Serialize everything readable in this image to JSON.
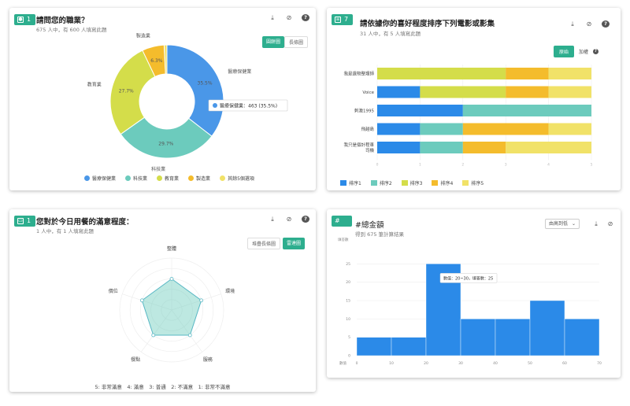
{
  "cards": [
    {
      "badge": "1",
      "title": "請問您的職業？",
      "subtitle": "675 人中，有 600 人填寫此題",
      "toggle": [
        "圓餅圖",
        "長條圖"
      ]
    },
    {
      "badge": "7",
      "title": "請依據你的喜好程度排序下列電影或影集",
      "subtitle": "31 人中，有 5 人填寫此題",
      "toggle": [
        "原始",
        "加權"
      ]
    },
    {
      "badge": "1",
      "title": "您對於今日用餐的滿意程度：",
      "subtitle": "1 人中，有 1 人填寫此題",
      "toggle": [
        "堆疊長條圖",
        "雷達圖"
      ],
      "scale_note": "5: 非常滿意　4: 滿意　3: 普通　2: 不滿意　1: 非常不滿意"
    },
    {
      "badge": "#",
      "title": "#總金額",
      "subtitle": "得到 675 筆計算結果",
      "dropdown": "由高到低"
    }
  ],
  "chart_data": [
    {
      "type": "pie",
      "title": "請問您的職業？",
      "categories": [
        "醫療保健業",
        "科技業",
        "教育業",
        "製造業",
        "其餘5個選項"
      ],
      "values": [
        35.5,
        29.7,
        27.7,
        6.3,
        0.8
      ],
      "labels": [
        "醫療保健業",
        "科技業",
        "教育業",
        "製造業",
        ""
      ],
      "value_labels": [
        "35.5%",
        "29.7%",
        "27.7%",
        "6.3%",
        ""
      ],
      "colors": [
        "#4a97e8",
        "#6ccbbd",
        "#d4dd4a",
        "#f4bc2c",
        "#f1e268"
      ],
      "tooltip": "醫療保健業：463 (35.5%)"
    },
    {
      "type": "bar",
      "orientation": "horizontal",
      "stacked": true,
      "categories": [
        "我是遺物整理師",
        "Voice",
        "刺激1995",
        "飛越島",
        "我只是個計程車司機"
      ],
      "series": [
        {
          "name": "排序1",
          "color": "#2b8ae8",
          "values": [
            0,
            1,
            2,
            1,
            1
          ]
        },
        {
          "name": "排序2",
          "color": "#6ccbbd",
          "values": [
            0,
            0,
            3,
            1,
            1
          ]
        },
        {
          "name": "排序3",
          "color": "#d4dd4a",
          "values": [
            3,
            2,
            0,
            0,
            0
          ]
        },
        {
          "name": "排序4",
          "color": "#f4bc2c",
          "values": [
            1,
            1,
            0,
            2,
            1
          ]
        },
        {
          "name": "排序5",
          "color": "#f1e268",
          "values": [
            1,
            1,
            0,
            1,
            2
          ]
        }
      ],
      "xlim": [
        0,
        5
      ],
      "xticks": [
        "0",
        "1",
        "2",
        "3",
        "4",
        "5"
      ]
    },
    {
      "type": "radar",
      "axes": [
        "整體",
        "環境",
        "服務",
        "餐點",
        "價位"
      ],
      "values": [
        3,
        3,
        3,
        3,
        3
      ],
      "max": 5
    },
    {
      "type": "bar",
      "title": "#總金額",
      "ylabel": "填答數",
      "xlabel": "數值",
      "bins": [
        [
          0,
          10
        ],
        [
          10,
          20
        ],
        [
          20,
          30
        ],
        [
          30,
          40
        ],
        [
          40,
          50
        ],
        [
          50,
          60
        ],
        [
          60,
          70
        ]
      ],
      "values": [
        5,
        5,
        25,
        10,
        10,
        15,
        10
      ],
      "xticks": [
        0,
        10,
        20,
        30,
        40,
        50,
        60,
        70
      ],
      "xtick_labels": [
        "0",
        "10",
        "20",
        "30",
        "40",
        "50",
        "60",
        "70"
      ],
      "yticks": [
        0,
        5,
        10,
        15,
        20,
        25
      ],
      "ylim": [
        0,
        30
      ],
      "tooltip": "數值：20~30，填答數：25",
      "color": "#2b8ae8"
    }
  ]
}
